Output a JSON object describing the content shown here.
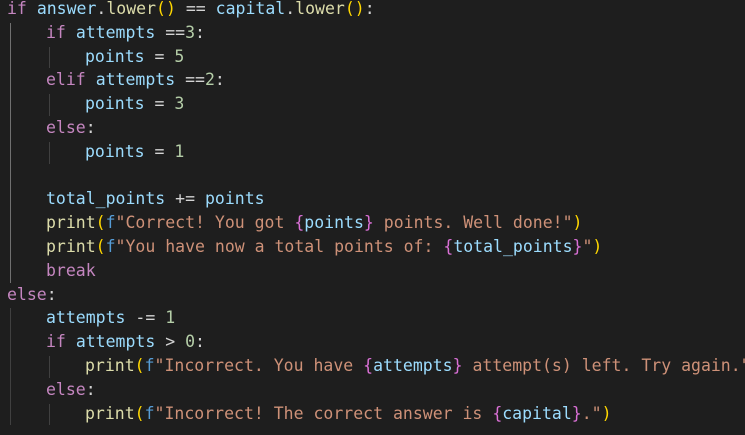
{
  "editor": {
    "lines": [
      {
        "indent": 0,
        "tokens": [
          {
            "t": "if",
            "c": "kw"
          },
          {
            "t": " ",
            "c": "plain"
          },
          {
            "t": "answer",
            "c": "var"
          },
          {
            "t": ".",
            "c": "plain"
          },
          {
            "t": "lower",
            "c": "fn"
          },
          {
            "t": "()",
            "c": "br1"
          },
          {
            "t": " == ",
            "c": "op"
          },
          {
            "t": "capital",
            "c": "var"
          },
          {
            "t": ".",
            "c": "plain"
          },
          {
            "t": "lower",
            "c": "fn"
          },
          {
            "t": "()",
            "c": "br1"
          },
          {
            "t": ":",
            "c": "plain"
          }
        ]
      },
      {
        "indent": 1,
        "tokens": [
          {
            "t": "if",
            "c": "kw"
          },
          {
            "t": " ",
            "c": "plain"
          },
          {
            "t": "attempts",
            "c": "var"
          },
          {
            "t": " ==",
            "c": "op"
          },
          {
            "t": "3",
            "c": "num"
          },
          {
            "t": ":",
            "c": "plain"
          }
        ]
      },
      {
        "indent": 2,
        "tokens": [
          {
            "t": "points",
            "c": "var"
          },
          {
            "t": " = ",
            "c": "op"
          },
          {
            "t": "5",
            "c": "num"
          }
        ]
      },
      {
        "indent": 1,
        "tokens": [
          {
            "t": "elif",
            "c": "kw"
          },
          {
            "t": " ",
            "c": "plain"
          },
          {
            "t": "attempts",
            "c": "var"
          },
          {
            "t": " ==",
            "c": "op"
          },
          {
            "t": "2",
            "c": "num"
          },
          {
            "t": ":",
            "c": "plain"
          }
        ]
      },
      {
        "indent": 2,
        "tokens": [
          {
            "t": "points",
            "c": "var"
          },
          {
            "t": " = ",
            "c": "op"
          },
          {
            "t": "3",
            "c": "num"
          }
        ]
      },
      {
        "indent": 1,
        "tokens": [
          {
            "t": "else",
            "c": "kw"
          },
          {
            "t": ":",
            "c": "plain"
          }
        ]
      },
      {
        "indent": 2,
        "tokens": [
          {
            "t": "points",
            "c": "var"
          },
          {
            "t": " = ",
            "c": "op"
          },
          {
            "t": "1",
            "c": "num"
          }
        ]
      },
      {
        "indent": 1,
        "tokens": []
      },
      {
        "indent": 1,
        "tokens": [
          {
            "t": "total_points",
            "c": "var"
          },
          {
            "t": " += ",
            "c": "op"
          },
          {
            "t": "points",
            "c": "var"
          }
        ]
      },
      {
        "indent": 1,
        "tokens": [
          {
            "t": "print",
            "c": "fn"
          },
          {
            "t": "(",
            "c": "br1"
          },
          {
            "t": "f",
            "c": "fpre"
          },
          {
            "t": "\"Correct! You got ",
            "c": "str"
          },
          {
            "t": "{",
            "c": "br2"
          },
          {
            "t": "points",
            "c": "var"
          },
          {
            "t": "}",
            "c": "br2"
          },
          {
            "t": " points. Well done!\"",
            "c": "str"
          },
          {
            "t": ")",
            "c": "br1"
          }
        ]
      },
      {
        "indent": 1,
        "tokens": [
          {
            "t": "print",
            "c": "fn"
          },
          {
            "t": "(",
            "c": "br1"
          },
          {
            "t": "f",
            "c": "fpre"
          },
          {
            "t": "\"You have now a total points of: ",
            "c": "str"
          },
          {
            "t": "{",
            "c": "br2"
          },
          {
            "t": "total_points",
            "c": "var"
          },
          {
            "t": "}",
            "c": "br2"
          },
          {
            "t": "\"",
            "c": "str"
          },
          {
            "t": ")",
            "c": "br1"
          }
        ]
      },
      {
        "indent": 1,
        "tokens": [
          {
            "t": "break",
            "c": "kw"
          }
        ]
      },
      {
        "indent": 0,
        "tokens": [
          {
            "t": "else",
            "c": "kw"
          },
          {
            "t": ":",
            "c": "plain"
          }
        ]
      },
      {
        "indent": 1,
        "tokens": [
          {
            "t": "attempts",
            "c": "var"
          },
          {
            "t": " -= ",
            "c": "op"
          },
          {
            "t": "1",
            "c": "num"
          }
        ]
      },
      {
        "indent": 1,
        "tokens": [
          {
            "t": "if",
            "c": "kw"
          },
          {
            "t": " ",
            "c": "plain"
          },
          {
            "t": "attempts",
            "c": "var"
          },
          {
            "t": " > ",
            "c": "op"
          },
          {
            "t": "0",
            "c": "num"
          },
          {
            "t": ":",
            "c": "plain"
          }
        ]
      },
      {
        "indent": 2,
        "tokens": [
          {
            "t": "print",
            "c": "fn"
          },
          {
            "t": "(",
            "c": "br1"
          },
          {
            "t": "f",
            "c": "fpre"
          },
          {
            "t": "\"Incorrect. You have ",
            "c": "str"
          },
          {
            "t": "{",
            "c": "br2"
          },
          {
            "t": "attempts",
            "c": "var"
          },
          {
            "t": "}",
            "c": "br2"
          },
          {
            "t": " attempt(s) left. Try again.\"",
            "c": "str"
          },
          {
            "t": ")",
            "c": "br1"
          }
        ]
      },
      {
        "indent": 1,
        "tokens": [
          {
            "t": "else",
            "c": "kw"
          },
          {
            "t": ":",
            "c": "plain"
          }
        ]
      },
      {
        "indent": 2,
        "tokens": [
          {
            "t": "print",
            "c": "fn"
          },
          {
            "t": "(",
            "c": "br1"
          },
          {
            "t": "f",
            "c": "fpre"
          },
          {
            "t": "\"Incorrect! The correct answer is ",
            "c": "str"
          },
          {
            "t": "{",
            "c": "br2"
          },
          {
            "t": "capital",
            "c": "var"
          },
          {
            "t": "}",
            "c": "br2"
          },
          {
            "t": ".\"",
            "c": "str"
          },
          {
            "t": ")",
            "c": "br1"
          }
        ]
      }
    ]
  },
  "colors": {
    "background": "#1e1e1e",
    "keyword": "#c586c0",
    "variable": "#9cdcfe",
    "function": "#dcdcaa",
    "number": "#b5cea8",
    "string": "#ce9178",
    "fstring_prefix": "#569cd6",
    "bracket_level1": "#ffd700",
    "bracket_level2": "#da70d6",
    "indent_guide": "#404040",
    "indent_guide_active": "#707070"
  }
}
